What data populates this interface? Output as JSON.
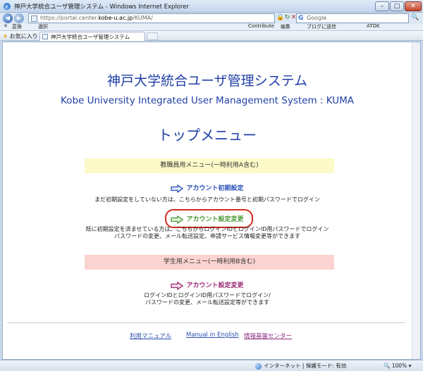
{
  "window": {
    "title": "神戸大学統合ユーザ管理システム - Windows Internet Explorer",
    "min": "–",
    "max": "□",
    "close": "✕"
  },
  "address": {
    "url_prefix": "https://portal.center.",
    "url_host": "kobe-u.ac.jp",
    "url_suffix": "/KUMA/",
    "search_engine": "G",
    "search_placeholder": "Google",
    "back": "◀",
    "forward": "▶",
    "lock": "🔒",
    "refresh": "↻",
    "stop": "✕",
    "search_go": "🔍"
  },
  "linksbar": {
    "close_x": "✕",
    "convert": "変換",
    "select": "選択",
    "contribute": "Contribute",
    "edit": "編集",
    "blog": "ブログに送信",
    "atok": "ATOK"
  },
  "favbar": {
    "favorites": "お気に入り",
    "tab_title": "神戸大学統合ユーザ管理システム"
  },
  "page": {
    "title": "神戸大学統合ユーザ管理システム",
    "subtitle": "Kobe University Integrated User Management System : KUMA",
    "menu_heading": "トップメニュー",
    "staff_section": "教職員用メニュー(一時利用A含む)",
    "init_link": "アカウント初期設定",
    "init_desc": "まだ初期設定をしていない方は、こちらからアカウント番号と初期パスワードでログイン",
    "change_link": "アカウント設定変更",
    "change_desc_1": "既に初期設定を済ませている方は、こちらからログインIDとログインID用パスワードでログイン",
    "change_desc_2": "パスワードの変更、メール転送設定、申請サービス情報変更等ができます",
    "student_section": "学生用メニュー(一時利用B含む)",
    "student_link": "アカウント設定変更",
    "student_desc_1": "ログインIDとログインID用パスワードでログイン/",
    "student_desc_2": "パスワードの変更、メール転送設定等ができます"
  },
  "footer": {
    "manual": "利用マニュアル",
    "english": "Manual in English",
    "center": "情報基盤センター"
  },
  "status": {
    "zone": "インターネット | 保護モード: 有効",
    "zoom": "100%"
  },
  "colors": {
    "title_blue": "#1f3fa6",
    "staff_band": "#fbfac8",
    "student_band": "#fbd3d0",
    "init_arrow": "#2a52b8",
    "change_arrow": "#4a9a37",
    "student_arrow": "#9b2c74",
    "highlight": "#d42a1e"
  }
}
